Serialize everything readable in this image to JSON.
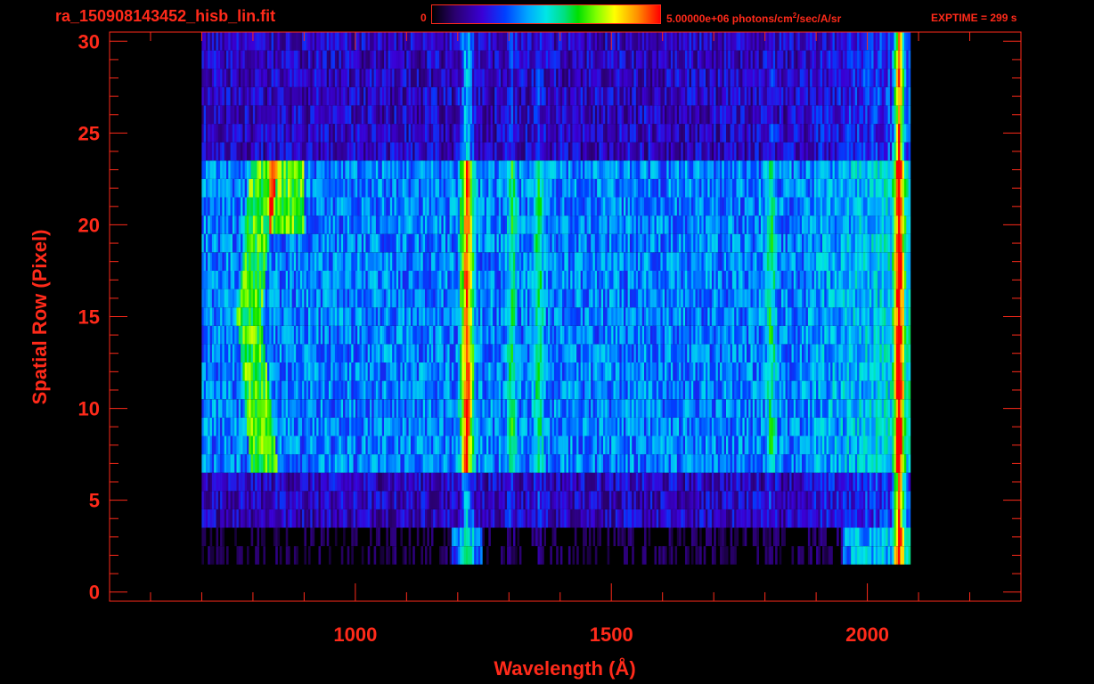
{
  "header": {
    "filename": "ra_150908143452_hisb_lin.fit",
    "colorbar_min": "0",
    "colorbar_max_prefix": "5.00000e+06 photons/cm",
    "colorbar_max_exp": "2",
    "colorbar_max_suffix": "/sec/A/sr",
    "exptime": "EXPTIME = 299 s"
  },
  "colors": {
    "axis": "#ff2a1a",
    "background": "#000000"
  },
  "chart_data": {
    "type": "heatmap",
    "title": "ra_150908143452_hisb_lin.fit",
    "xlabel": "Wavelength (Å)",
    "ylabel": "Spatial Row (Pixel)",
    "xlim": [
      520,
      2300
    ],
    "ylim": [
      -0.5,
      30.5
    ],
    "xticks": [
      1000,
      1500,
      2000
    ],
    "xtick_labels": [
      "1000",
      "1500",
      "2000"
    ],
    "yticks": [
      0,
      5,
      10,
      15,
      20,
      25,
      30
    ],
    "ytick_labels": [
      "0",
      "5",
      "10",
      "15",
      "20",
      "25",
      "30"
    ],
    "colorbar": {
      "min": 0,
      "max": 5000000,
      "units": "photons/cm^2/sec/A/sr",
      "colormap": "rainbow"
    },
    "exptime_s": 299,
    "features": {
      "bright_slit_rows": [
        7,
        23
      ],
      "faint_rows": [
        4,
        30
      ],
      "wavelength_coverage": [
        700,
        2080
      ],
      "emission_lines_A": [
        1216,
        1304,
        1356,
        1810,
        2060
      ]
    }
  }
}
